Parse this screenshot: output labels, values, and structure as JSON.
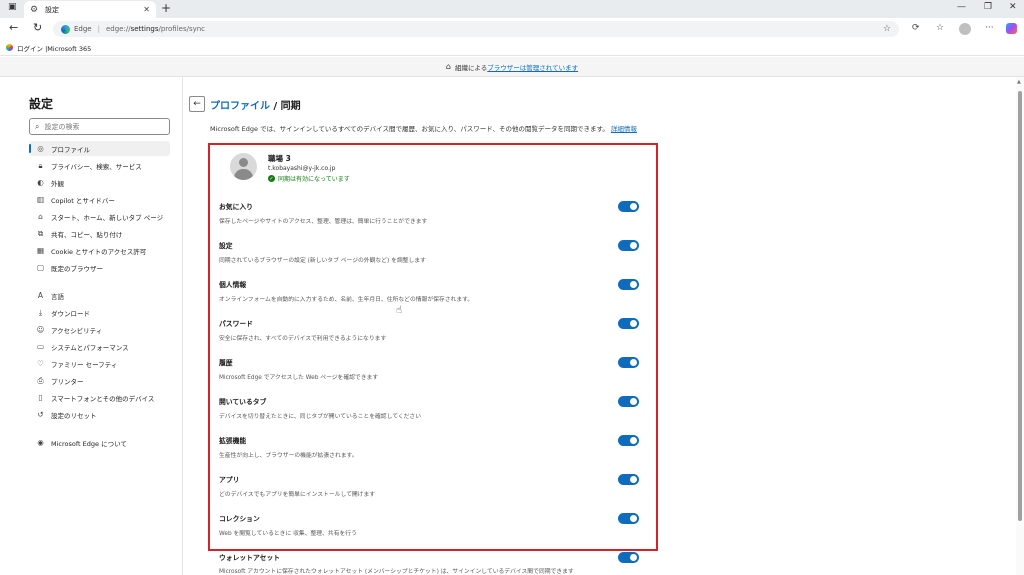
{
  "browser": {
    "tab_title": "設定",
    "new_tab": "+",
    "address_site": "Edge",
    "address_url_prefix": "edge://",
    "address_url_bold": "settings",
    "address_url_suffix": "/profiles/sync",
    "favorites": "ログイン |Microsoft 365"
  },
  "banner": {
    "prefix": "組織による",
    "link": "ブラウザーは管理されています"
  },
  "sidebar": {
    "title": "設定",
    "search_placeholder": "設定の検索",
    "items": [
      {
        "label": "プロファイル",
        "icon": "profile-icon",
        "active": true
      },
      {
        "label": "プライバシー、検索、サービス",
        "icon": "lock-icon"
      },
      {
        "label": "外観",
        "icon": "appearance-icon"
      },
      {
        "label": "Copilot とサイドバー",
        "icon": "sidebar-icon"
      },
      {
        "label": "スタート、ホーム、新しいタブ ページ",
        "icon": "home-icon"
      },
      {
        "label": "共有、コピー、貼り付け",
        "icon": "share-icon"
      },
      {
        "label": "Cookie とサイトのアクセス許可",
        "icon": "cookie-icon"
      },
      {
        "label": "既定のブラウザー",
        "icon": "browser-icon"
      },
      {
        "label": "言語",
        "icon": "language-icon"
      },
      {
        "label": "ダウンロード",
        "icon": "download-icon"
      },
      {
        "label": "アクセシビリティ",
        "icon": "accessibility-icon"
      },
      {
        "label": "システムとパフォーマンス",
        "icon": "system-icon"
      },
      {
        "label": "ファミリー セーフティ",
        "icon": "family-icon"
      },
      {
        "label": "プリンター",
        "icon": "printer-icon"
      },
      {
        "label": "スマートフォンとその他のデバイス",
        "icon": "phone-icon"
      },
      {
        "label": "設定のリセット",
        "icon": "reset-icon"
      },
      {
        "label": "Microsoft Edge について",
        "icon": "edge-icon"
      }
    ]
  },
  "main": {
    "breadcrumb_link": "プロファイル",
    "breadcrumb_sep": "/",
    "breadcrumb_current": "同期",
    "description": "Microsoft Edge では、サインインしているすべてのデバイス間で履歴、お気に入り、パスワード、その他の閲覧データを同期できます。",
    "description_link": "詳細情報",
    "profile": {
      "name": "職場 3",
      "email": "t.kobayashi@y-jk.co.jp",
      "status": "同期は有効になっています"
    },
    "sync_items": [
      {
        "title": "お気に入り",
        "desc": "保存したページやサイトのアクセス、整理、管理は、簡単に行うことができます",
        "on": true
      },
      {
        "title": "設定",
        "desc": "同期されているブラウザーの設定 (新しいタブ ページの外観など) を調整します",
        "on": true
      },
      {
        "title": "個人情報",
        "desc": "オンラインフォームを自動的に入力するため、名前、生年月日、住所などの情報が保存されます。",
        "on": true
      },
      {
        "title": "パスワード",
        "desc": "安全に保存され、すべてのデバイスで利用できるようになります",
        "on": true
      },
      {
        "title": "履歴",
        "desc": "Microsoft Edge でアクセスした Web ページを確認できます",
        "on": true
      },
      {
        "title": "開いているタブ",
        "desc": "デバイスを切り替えたときに、同じタブが開いていることを確認してください",
        "on": true
      },
      {
        "title": "拡張機能",
        "desc": "生産性が向上し、ブラウザーの機能が拡張されます。",
        "on": true
      },
      {
        "title": "アプリ",
        "desc": "どのデバイスでもアプリを簡単にインストールして開けます",
        "on": true
      },
      {
        "title": "コレクション",
        "desc": "Web を閲覧しているときに 収集、整理、共有を行う",
        "on": true
      },
      {
        "title": "ウォレットアセット",
        "desc": "Microsoft アカウントに保存されたウォレットアセット (メンバーシップとチケット) は、サインインしているデバイス間で同期できます",
        "on": true
      }
    ]
  }
}
